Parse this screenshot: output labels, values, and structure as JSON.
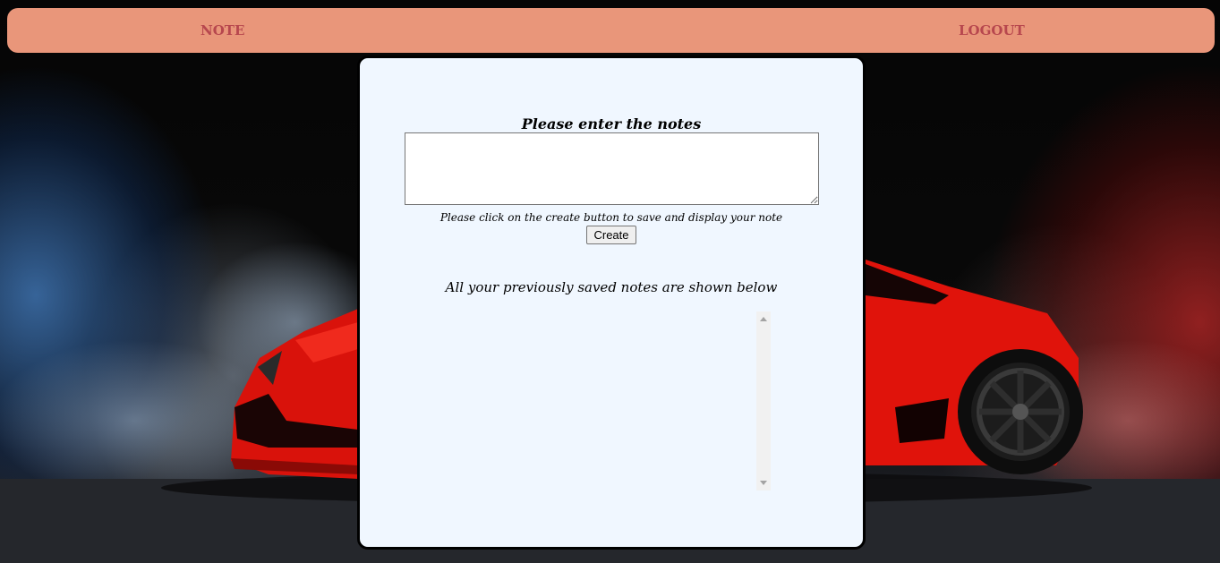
{
  "nav": {
    "note_label": "NOTE",
    "logout_label": "LOGOUT"
  },
  "form": {
    "title": "Please enter the notes",
    "note_value": "",
    "hint": "Please click on the create button to save and display your note",
    "create_label": "Create"
  },
  "saved": {
    "caption": "All your previously saved notes are shown below",
    "notes": []
  },
  "icons": {
    "scroll_up": "scroll-up-arrow-icon",
    "scroll_down": "scroll-down-arrow-icon",
    "resize": "resize-grip-icon"
  },
  "colors": {
    "navbar_bg": "#e9967a",
    "nav_text": "#b7474e",
    "card_bg": "#f0f7ff",
    "card_border": "#000000",
    "car_red": "#e8150c"
  }
}
